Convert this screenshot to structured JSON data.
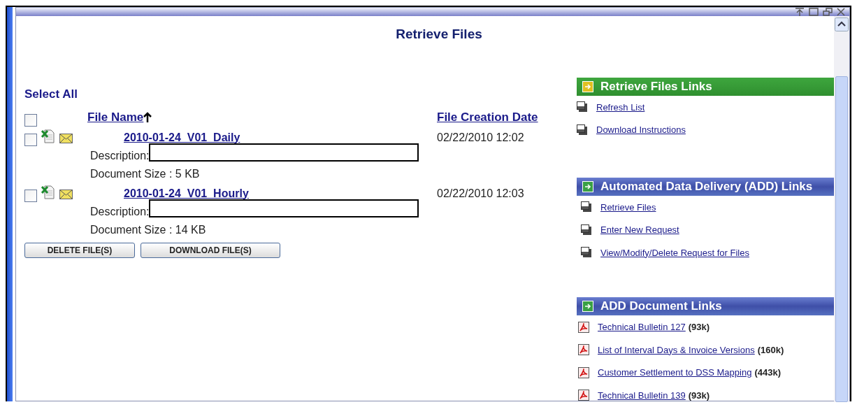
{
  "page_title": "Retrieve Files",
  "select_all": {
    "label": "Select All",
    "checked": false
  },
  "columns": [
    {
      "label": "File Name",
      "sorted": true
    },
    {
      "label": "File Creation Date",
      "sorted": false
    }
  ],
  "files": [
    {
      "name": "2010-01-24_V01_Daily",
      "checked": false,
      "description_label": "Description:",
      "size": "Document Size : 5 KB",
      "created": "02/22/2010 12:02"
    },
    {
      "name": "2010-01-24_V01_Hourly",
      "checked": false,
      "description_label": "Description:",
      "size": "Document Size : 14 KB",
      "created": "02/22/2010 12:03"
    }
  ],
  "buttons": [
    "DELETE FILE(S)",
    "DOWNLOAD FILE(S)"
  ],
  "sections": [
    {
      "title": "Retrieve Files Links",
      "kind": "green",
      "links": [
        {
          "kind": "page",
          "label": "Refresh List"
        },
        {
          "kind": "page",
          "label": "Download Instructions"
        }
      ]
    },
    {
      "title": "Automated Data Delivery (ADD) Links",
      "kind": "blue",
      "links": [
        {
          "kind": "page",
          "label": "Retrieve Files"
        },
        {
          "kind": "page",
          "label": "Enter New Request"
        },
        {
          "kind": "page",
          "label": "View/Modify/Delete Request for Files"
        }
      ]
    },
    {
      "title": "ADD Document Links",
      "kind": "blue",
      "links": [
        {
          "kind": "pdf",
          "label": "Technical Bulletin 127",
          "size": "(93k)"
        },
        {
          "kind": "pdf",
          "label": "List of Interval Days & Invoice Versions",
          "size": "(160k)"
        },
        {
          "kind": "pdf",
          "label": "Customer Settlement to DSS Mapping",
          "size": "(443k)"
        },
        {
          "kind": "pdf",
          "label": "Technical Bulletin 139",
          "size": "(93k)"
        }
      ]
    }
  ]
}
